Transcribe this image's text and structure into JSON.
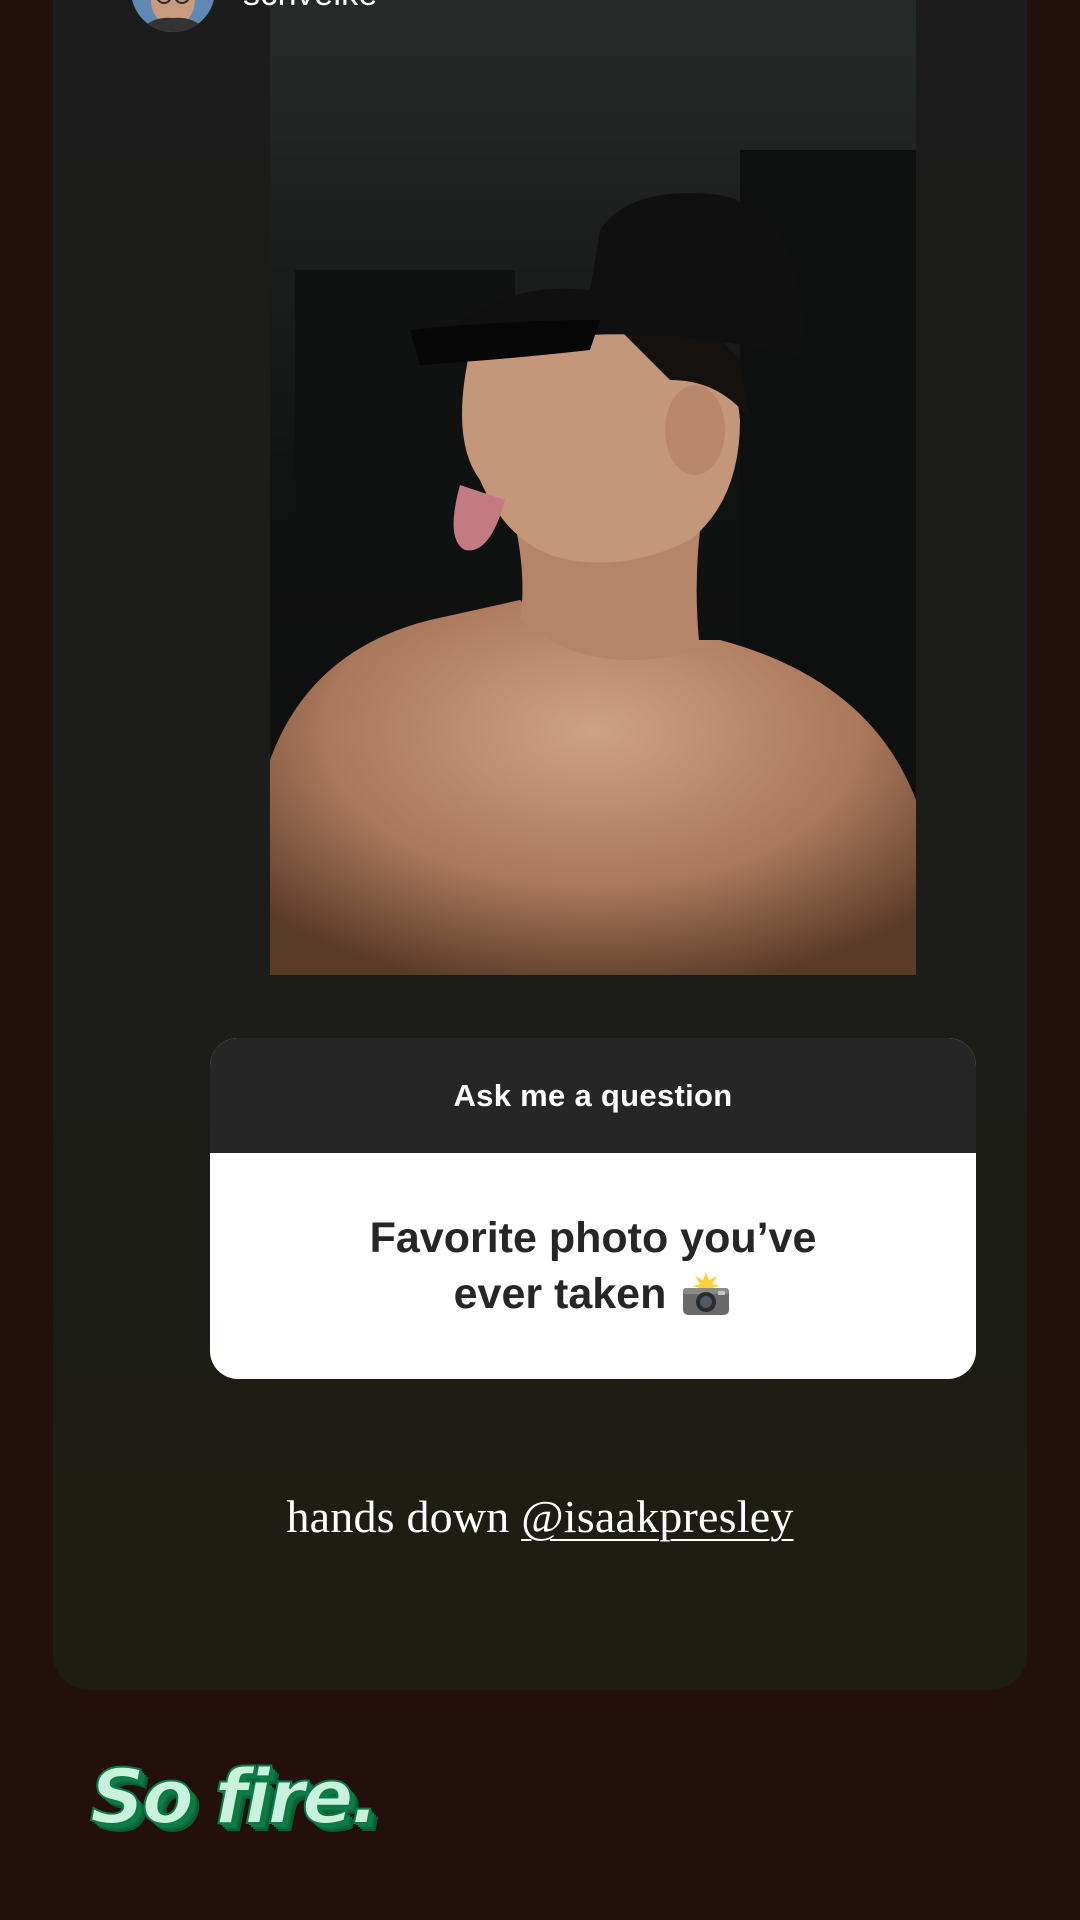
{
  "story": {
    "username": "schvelke"
  },
  "question_sticker": {
    "header": "Ask me a question",
    "question_line1": "Favorite photo you’ve",
    "question_line2": "ever taken",
    "question_emoji": "camera-with-flash-icon"
  },
  "reply": {
    "prefix": "hands down ",
    "mention": "@isaakpresley"
  },
  "caption": {
    "text": "So fire."
  },
  "colors": {
    "page_background": "#230f0b",
    "card_background": "#1c1c1c",
    "sticker_header": "#262626",
    "caption_fill": "#c9f2dc",
    "caption_outline": "#0d7a45"
  }
}
